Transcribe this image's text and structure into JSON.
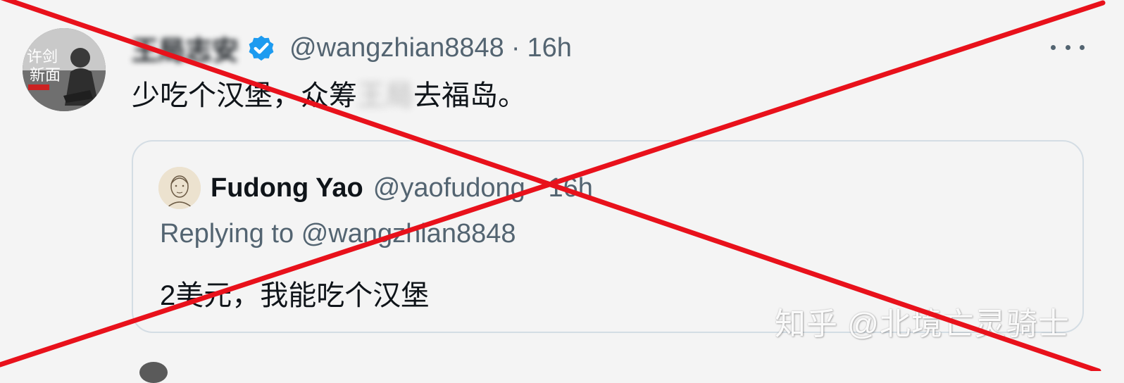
{
  "tweet": {
    "display_name": "王局志安",
    "verified_icon": "verified-badge-icon",
    "handle": "@wangzhian8848",
    "separator": "·",
    "time": "16h",
    "more_icon": "more-options-icon",
    "text_before": "少吃个汉堡，众筹",
    "text_redacted": "王局",
    "text_after": "去福岛。"
  },
  "quote": {
    "display_name": "Fudong Yao",
    "handle": "@yaofudong",
    "separator": "·",
    "time": "16h",
    "replying_label": "Replying to",
    "replying_handle": "@wangzhian8848",
    "text": "2美元，我能吃个汉堡"
  },
  "watermark": "知乎 @北境亡灵骑士",
  "colors": {
    "cross": "#e8111b",
    "verified": "#1d9bf0",
    "secondary_text": "#536471",
    "border": "#d4dde4"
  }
}
